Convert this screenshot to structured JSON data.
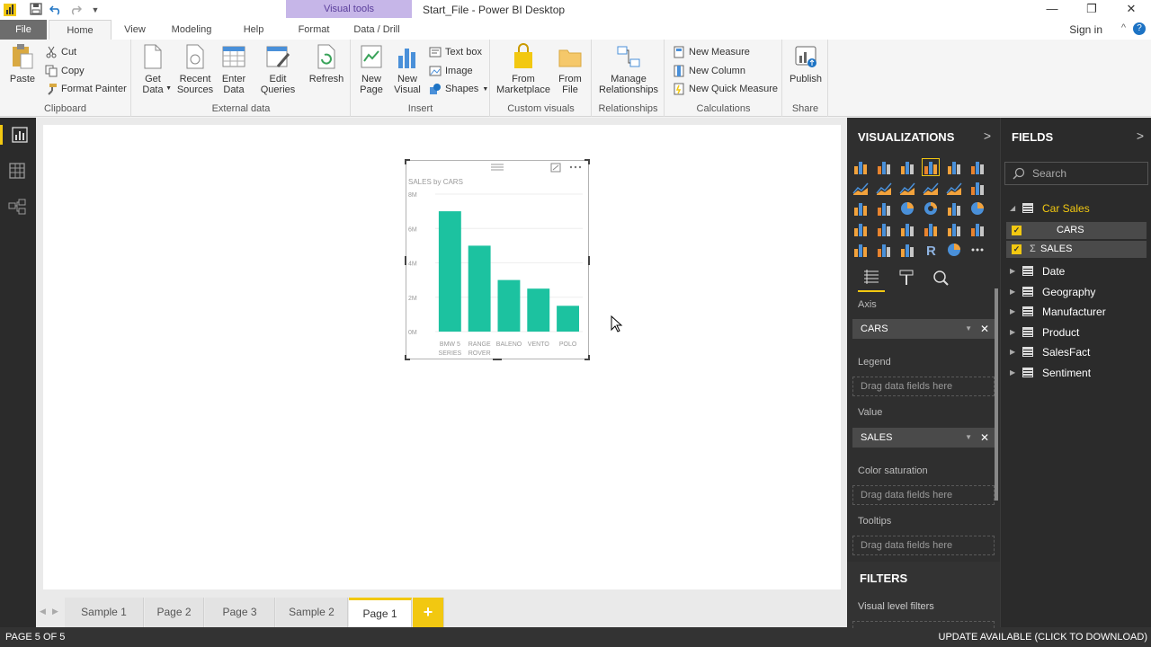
{
  "titlebar": {
    "visual_tools": "Visual tools",
    "window_title": "Start_File - Power BI Desktop"
  },
  "tabs": {
    "file": "File",
    "home": "Home",
    "view": "View",
    "modeling": "Modeling",
    "help": "Help",
    "format": "Format",
    "data_drill": "Data / Drill",
    "sign_in": "Sign in"
  },
  "ribbon": {
    "clipboard": {
      "paste": "Paste",
      "cut": "Cut",
      "copy": "Copy",
      "format_painter": "Format Painter",
      "label": "Clipboard"
    },
    "external": {
      "get_data_1": "Get",
      "get_data_2": "Data",
      "recent_1": "Recent",
      "recent_2": "Sources",
      "enter_1": "Enter",
      "enter_2": "Data",
      "edit_1": "Edit",
      "edit_2": "Queries",
      "refresh": "Refresh",
      "label": "External data"
    },
    "insert": {
      "new_page_1": "New",
      "new_page_2": "Page",
      "new_visual_1": "New",
      "new_visual_2": "Visual",
      "text_box": "Text box",
      "image": "Image",
      "shapes": "Shapes",
      "label": "Insert"
    },
    "custom": {
      "from_market_1": "From",
      "from_market_2": "Marketplace",
      "from_file_1": "From",
      "from_file_2": "File",
      "label": "Custom visuals"
    },
    "relationships": {
      "manage_1": "Manage",
      "manage_2": "Relationships",
      "label": "Relationships"
    },
    "calculations": {
      "new_measure": "New Measure",
      "new_column": "New Column",
      "new_quick_measure": "New Quick Measure",
      "label": "Calculations"
    },
    "share": {
      "publish": "Publish",
      "label": "Share"
    }
  },
  "chart_data": {
    "type": "bar",
    "title": "SALES by CARS",
    "categories": [
      "BMW 5 SERIES",
      "RANGE ROVER",
      "BALENO",
      "VENTO",
      "POLO"
    ],
    "category_lines": [
      [
        "BMW 5",
        "SERIES"
      ],
      [
        "RANGE",
        "ROVER"
      ],
      [
        "BALENO"
      ],
      [
        "VENTO"
      ],
      [
        "POLO"
      ]
    ],
    "values": [
      7000000,
      5000000,
      3000000,
      2500000,
      1500000
    ],
    "ylim": [
      0,
      8000000
    ],
    "yticks": [
      "0M",
      "2M",
      "4M",
      "6M",
      "8M"
    ],
    "ytick_values": [
      0,
      2000000,
      4000000,
      6000000,
      8000000
    ],
    "bar_color": "#1cc2a0",
    "grid": true
  },
  "page_tabs": [
    "Sample 1",
    "Page 2",
    "Page 3",
    "Sample 2",
    "Page 1"
  ],
  "active_page": "Page 1",
  "add_page": "+",
  "status": {
    "left": "PAGE 5 OF 5",
    "right": "UPDATE AVAILABLE (CLICK TO DOWNLOAD)"
  },
  "viz": {
    "header": "VISUALIZATIONS",
    "axis_label": "Axis",
    "axis_value": "CARS",
    "legend_label": "Legend",
    "legend_placeholder": "Drag data fields here",
    "value_label": "Value",
    "value_value": "SALES",
    "color_sat_label": "Color saturation",
    "color_sat_placeholder": "Drag data fields here",
    "tooltips_label": "Tooltips",
    "tooltips_placeholder": "Drag data fields here"
  },
  "filters": {
    "header": "FILTERS",
    "visual_level": "Visual level filters"
  },
  "fields": {
    "header": "FIELDS",
    "search_placeholder": "Search",
    "expanded_table": "Car Sales",
    "expanded_fields": [
      "CARS",
      "SALES"
    ],
    "tables": [
      "Date",
      "Geography",
      "Manufacturer",
      "Product",
      "SalesFact",
      "Sentiment"
    ]
  },
  "colors": {
    "accent": "#f2c811",
    "visual_tools": "#c6b6e8",
    "dark_pane": "#2f2f2f"
  }
}
